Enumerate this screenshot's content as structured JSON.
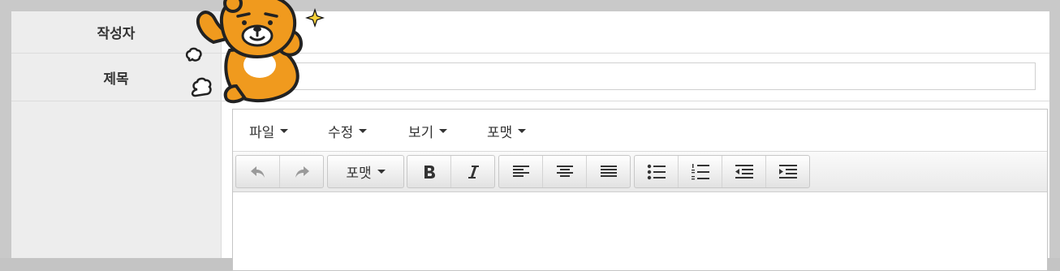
{
  "form": {
    "author_label": "작성자",
    "title_label": "제목",
    "title_value": ""
  },
  "editor": {
    "menu": [
      "파일",
      "수정",
      "보기",
      "포맷"
    ],
    "toolbar": {
      "format_label": "포맷",
      "buttons": [
        "undo-icon",
        "redo-icon",
        "bold-icon",
        "italic-icon",
        "align-left-icon",
        "align-center-icon",
        "align-justify-icon",
        "bullet-list-icon",
        "numbered-list-icon",
        "outdent-icon",
        "indent-icon"
      ],
      "disabled": [
        "undo-icon",
        "redo-icon"
      ]
    }
  },
  "mascot": {
    "name": "lion-mascot-sticker",
    "color": "#f09a1e"
  }
}
